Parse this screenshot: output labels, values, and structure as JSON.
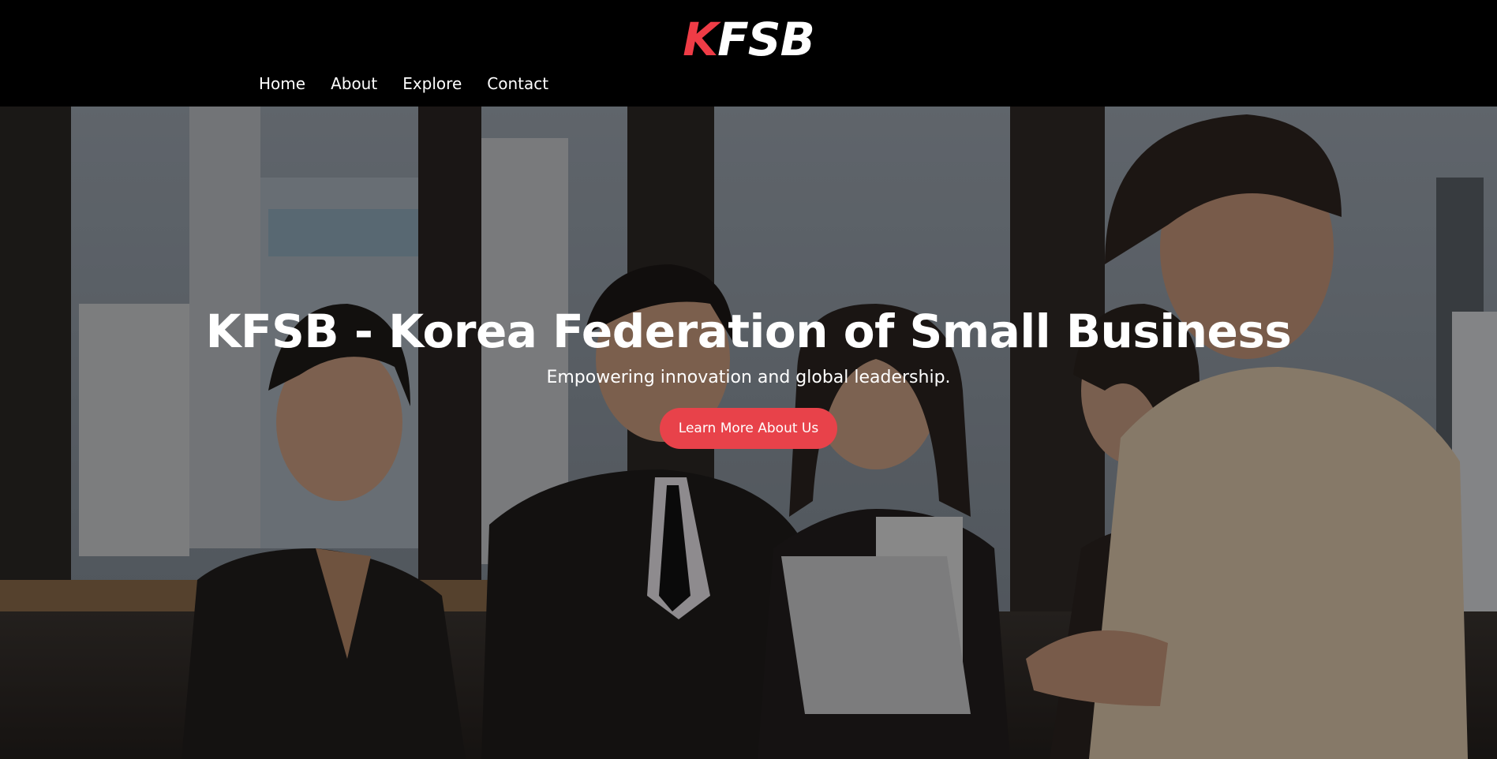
{
  "header": {
    "logo_accent": "K",
    "logo_rest": "FSB",
    "nav": [
      {
        "label": "Home"
      },
      {
        "label": "About"
      },
      {
        "label": "Explore"
      },
      {
        "label": "Contact"
      }
    ]
  },
  "hero": {
    "title": "KFSB - Korea Federation of Small Business",
    "subtitle": "Empowering innovation and global leadership.",
    "cta_label": "Learn More About Us",
    "background_image": "business-team-photo"
  },
  "colors": {
    "header_bg": "#000000",
    "accent": "#ef3c46",
    "button_bg": "#e8424a",
    "text": "#ffffff"
  }
}
